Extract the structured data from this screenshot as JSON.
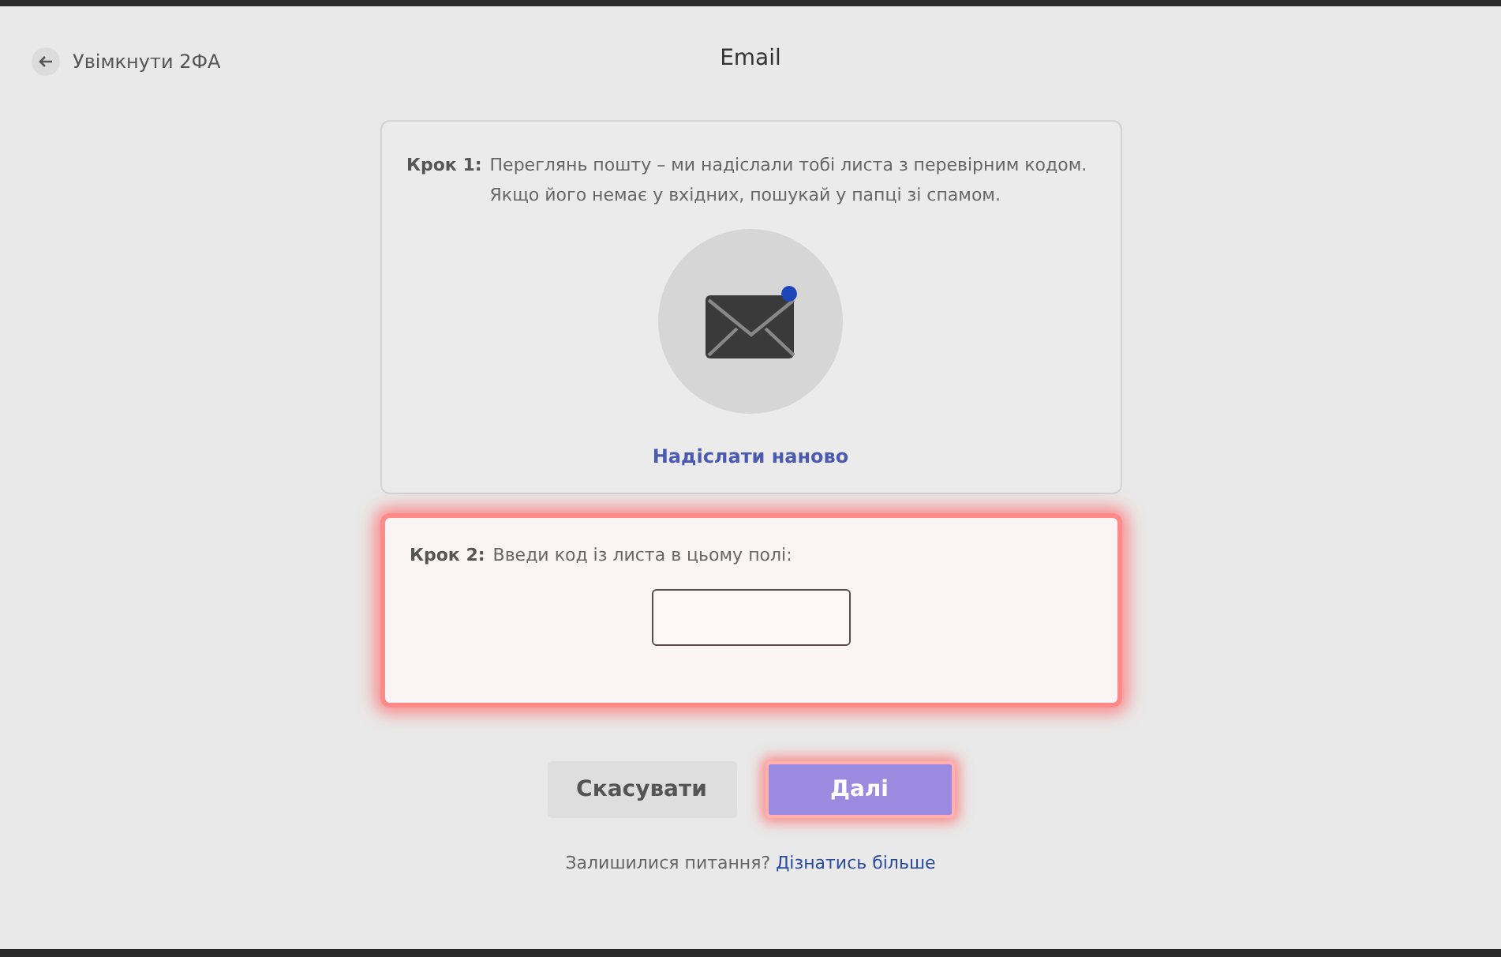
{
  "header": {
    "back_label": "Увімкнути 2ФА",
    "title": "Email"
  },
  "step1": {
    "label": "Крок 1:",
    "text": "Переглянь пошту – ми надіслали тобі листа з перевірним кодом.",
    "text_line2": "Якщо його немає у вхідних, пошукай у папці зі спамом.",
    "unread": true,
    "resend": "Надіслати наново",
    "highlighted": false
  },
  "step2": {
    "label": "Крок 2:",
    "text": "Введи код із листа в цьому полі:",
    "highlighted": true
  },
  "buttons": [
    {
      "label": "Скасувати",
      "kind": "secondary",
      "highlighted": false
    },
    {
      "label": "Далі",
      "kind": "primary",
      "highlighted": true
    }
  ],
  "footer": {
    "text": "Залишилися питання?",
    "link": "Дізнатись більше"
  }
}
